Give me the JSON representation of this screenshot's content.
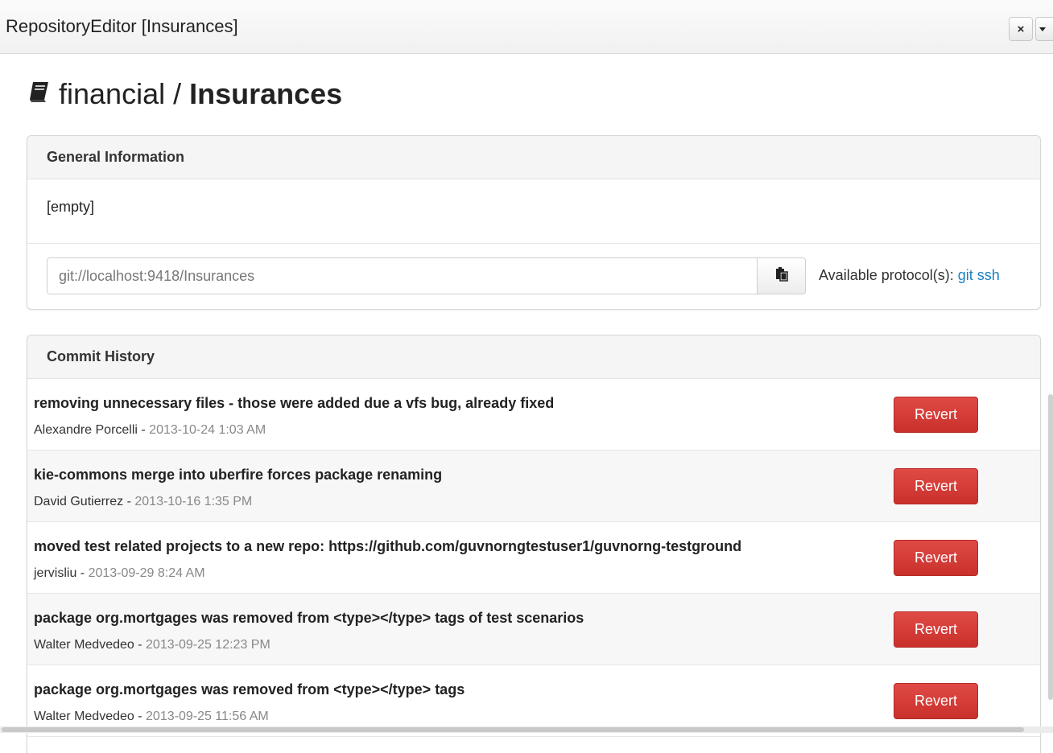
{
  "window": {
    "title": "RepositoryEditor [Insurances]",
    "close_glyph": "×"
  },
  "heading": {
    "icon": "book-icon",
    "owner": "financial",
    "separator": "/",
    "repo": "Insurances"
  },
  "general": {
    "title": "General Information",
    "description": "[empty]",
    "url_value": "git://localhost:9418/Insurances",
    "protocols_label": "Available protocol(s):",
    "protocols": [
      "git",
      "ssh"
    ]
  },
  "history": {
    "title": "Commit History",
    "revert_label": "Revert",
    "commits": [
      {
        "message": "removing unnecessary files - those were added due a vfs bug, already fixed",
        "author": "Alexandre Porcelli",
        "separator": " - ",
        "date": "2013-10-24 1:03 AM"
      },
      {
        "message": "kie-commons merge into uberfire forces package renaming",
        "author": "David Gutierrez",
        "separator": " - ",
        "date": "2013-10-16 1:35 PM"
      },
      {
        "message": "moved test related projects to a new repo: https://github.com/guvnorngtestuser1/guvnorng-testground",
        "author": "jervisliu",
        "separator": " - ",
        "date": "2013-09-29 8:24 AM"
      },
      {
        "message": "package org.mortgages was removed from <type></type> tags of test scenarios",
        "author": "Walter Medvedeo",
        "separator": " - ",
        "date": "2013-09-25 12:23 PM"
      },
      {
        "message": "package org.mortgages was removed from <type></type> tags",
        "author": "Walter Medvedeo",
        "separator": " - ",
        "date": "2013-09-25 11:56 AM"
      }
    ]
  },
  "colors": {
    "revert_button": "#d9534f",
    "link": "#1a7fc1"
  }
}
